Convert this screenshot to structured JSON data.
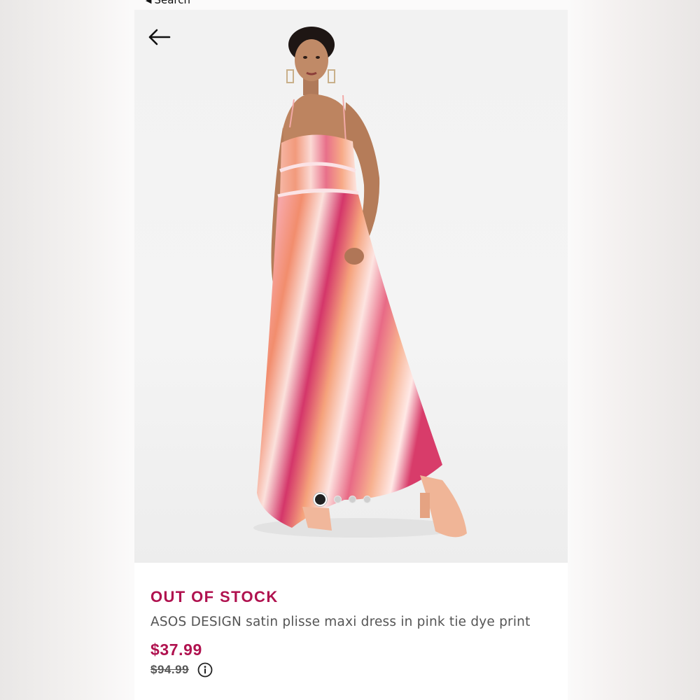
{
  "status_bar": {
    "back_label": "Search"
  },
  "gallery": {
    "image_count": 4,
    "active_index": 0
  },
  "product": {
    "stock_status": "OUT OF STOCK",
    "title": "ASOS DESIGN satin plisse maxi dress in pink tie dye print",
    "price_now": "$37.99",
    "price_was": "$94.99"
  },
  "colors": {
    "accent": "#b0124f",
    "text_secondary": "#555555"
  },
  "icons": {
    "back": "arrow-left-icon",
    "info": "info-circle-icon"
  }
}
